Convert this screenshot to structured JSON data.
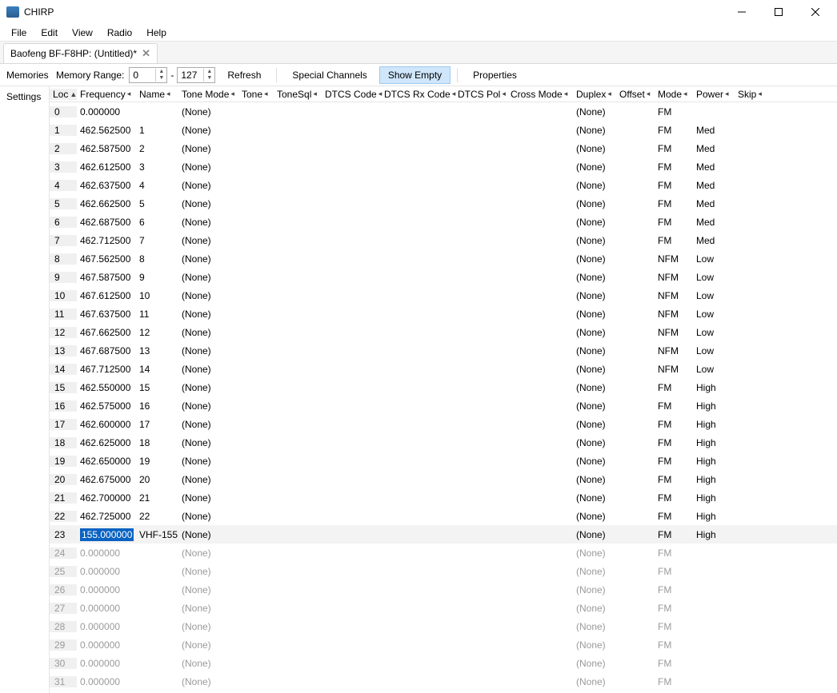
{
  "window": {
    "title": "CHIRP"
  },
  "menu": [
    "File",
    "Edit",
    "View",
    "Radio",
    "Help"
  ],
  "tab": {
    "label": "Baofeng BF-F8HP: (Untitled)*"
  },
  "sidebar": {
    "memories": "Memories",
    "settings": "Settings"
  },
  "toolbar": {
    "memory_range_label": "Memory Range:",
    "range_from": "0",
    "range_sep": "-",
    "range_to": "127",
    "refresh": "Refresh",
    "special": "Special Channels",
    "show_empty": "Show Empty",
    "properties": "Properties"
  },
  "columns": [
    "Loc",
    "Frequency",
    "Name",
    "Tone Mode",
    "Tone",
    "ToneSql",
    "DTCS Code",
    "DTCS Rx Code",
    "DTCS Pol",
    "Cross Mode",
    "Duplex",
    "Offset",
    "Mode",
    "Power",
    "Skip"
  ],
  "rows": [
    {
      "loc": "0",
      "freq": "0.000000",
      "name": "",
      "tonemode": "(None)",
      "duplex": "(None)",
      "mode": "FM",
      "power": "",
      "empty": false
    },
    {
      "loc": "1",
      "freq": "462.562500",
      "name": "1",
      "tonemode": "(None)",
      "duplex": "(None)",
      "mode": "FM",
      "power": "Med",
      "empty": false
    },
    {
      "loc": "2",
      "freq": "462.587500",
      "name": "2",
      "tonemode": "(None)",
      "duplex": "(None)",
      "mode": "FM",
      "power": "Med",
      "empty": false
    },
    {
      "loc": "3",
      "freq": "462.612500",
      "name": "3",
      "tonemode": "(None)",
      "duplex": "(None)",
      "mode": "FM",
      "power": "Med",
      "empty": false
    },
    {
      "loc": "4",
      "freq": "462.637500",
      "name": "4",
      "tonemode": "(None)",
      "duplex": "(None)",
      "mode": "FM",
      "power": "Med",
      "empty": false
    },
    {
      "loc": "5",
      "freq": "462.662500",
      "name": "5",
      "tonemode": "(None)",
      "duplex": "(None)",
      "mode": "FM",
      "power": "Med",
      "empty": false
    },
    {
      "loc": "6",
      "freq": "462.687500",
      "name": "6",
      "tonemode": "(None)",
      "duplex": "(None)",
      "mode": "FM",
      "power": "Med",
      "empty": false
    },
    {
      "loc": "7",
      "freq": "462.712500",
      "name": "7",
      "tonemode": "(None)",
      "duplex": "(None)",
      "mode": "FM",
      "power": "Med",
      "empty": false
    },
    {
      "loc": "8",
      "freq": "467.562500",
      "name": "8",
      "tonemode": "(None)",
      "duplex": "(None)",
      "mode": "NFM",
      "power": "Low",
      "empty": false
    },
    {
      "loc": "9",
      "freq": "467.587500",
      "name": "9",
      "tonemode": "(None)",
      "duplex": "(None)",
      "mode": "NFM",
      "power": "Low",
      "empty": false
    },
    {
      "loc": "10",
      "freq": "467.612500",
      "name": "10",
      "tonemode": "(None)",
      "duplex": "(None)",
      "mode": "NFM",
      "power": "Low",
      "empty": false
    },
    {
      "loc": "11",
      "freq": "467.637500",
      "name": "11",
      "tonemode": "(None)",
      "duplex": "(None)",
      "mode": "NFM",
      "power": "Low",
      "empty": false
    },
    {
      "loc": "12",
      "freq": "467.662500",
      "name": "12",
      "tonemode": "(None)",
      "duplex": "(None)",
      "mode": "NFM",
      "power": "Low",
      "empty": false
    },
    {
      "loc": "13",
      "freq": "467.687500",
      "name": "13",
      "tonemode": "(None)",
      "duplex": "(None)",
      "mode": "NFM",
      "power": "Low",
      "empty": false
    },
    {
      "loc": "14",
      "freq": "467.712500",
      "name": "14",
      "tonemode": "(None)",
      "duplex": "(None)",
      "mode": "NFM",
      "power": "Low",
      "empty": false
    },
    {
      "loc": "15",
      "freq": "462.550000",
      "name": "15",
      "tonemode": "(None)",
      "duplex": "(None)",
      "mode": "FM",
      "power": "High",
      "empty": false
    },
    {
      "loc": "16",
      "freq": "462.575000",
      "name": "16",
      "tonemode": "(None)",
      "duplex": "(None)",
      "mode": "FM",
      "power": "High",
      "empty": false
    },
    {
      "loc": "17",
      "freq": "462.600000",
      "name": "17",
      "tonemode": "(None)",
      "duplex": "(None)",
      "mode": "FM",
      "power": "High",
      "empty": false
    },
    {
      "loc": "18",
      "freq": "462.625000",
      "name": "18",
      "tonemode": "(None)",
      "duplex": "(None)",
      "mode": "FM",
      "power": "High",
      "empty": false
    },
    {
      "loc": "19",
      "freq": "462.650000",
      "name": "19",
      "tonemode": "(None)",
      "duplex": "(None)",
      "mode": "FM",
      "power": "High",
      "empty": false
    },
    {
      "loc": "20",
      "freq": "462.675000",
      "name": "20",
      "tonemode": "(None)",
      "duplex": "(None)",
      "mode": "FM",
      "power": "High",
      "empty": false
    },
    {
      "loc": "21",
      "freq": "462.700000",
      "name": "21",
      "tonemode": "(None)",
      "duplex": "(None)",
      "mode": "FM",
      "power": "High",
      "empty": false
    },
    {
      "loc": "22",
      "freq": "462.725000",
      "name": "22",
      "tonemode": "(None)",
      "duplex": "(None)",
      "mode": "FM",
      "power": "High",
      "empty": false
    },
    {
      "loc": "23",
      "freq": "155.000000",
      "name": "VHF-155",
      "tonemode": "(None)",
      "duplex": "(None)",
      "mode": "FM",
      "power": "High",
      "empty": false,
      "selected": true
    },
    {
      "loc": "24",
      "freq": "0.000000",
      "name": "",
      "tonemode": "(None)",
      "duplex": "(None)",
      "mode": "FM",
      "power": "",
      "empty": true
    },
    {
      "loc": "25",
      "freq": "0.000000",
      "name": "",
      "tonemode": "(None)",
      "duplex": "(None)",
      "mode": "FM",
      "power": "",
      "empty": true
    },
    {
      "loc": "26",
      "freq": "0.000000",
      "name": "",
      "tonemode": "(None)",
      "duplex": "(None)",
      "mode": "FM",
      "power": "",
      "empty": true
    },
    {
      "loc": "27",
      "freq": "0.000000",
      "name": "",
      "tonemode": "(None)",
      "duplex": "(None)",
      "mode": "FM",
      "power": "",
      "empty": true
    },
    {
      "loc": "28",
      "freq": "0.000000",
      "name": "",
      "tonemode": "(None)",
      "duplex": "(None)",
      "mode": "FM",
      "power": "",
      "empty": true
    },
    {
      "loc": "29",
      "freq": "0.000000",
      "name": "",
      "tonemode": "(None)",
      "duplex": "(None)",
      "mode": "FM",
      "power": "",
      "empty": true
    },
    {
      "loc": "30",
      "freq": "0.000000",
      "name": "",
      "tonemode": "(None)",
      "duplex": "(None)",
      "mode": "FM",
      "power": "",
      "empty": true
    },
    {
      "loc": "31",
      "freq": "0.000000",
      "name": "",
      "tonemode": "(None)",
      "duplex": "(None)",
      "mode": "FM",
      "power": "",
      "empty": true
    }
  ]
}
